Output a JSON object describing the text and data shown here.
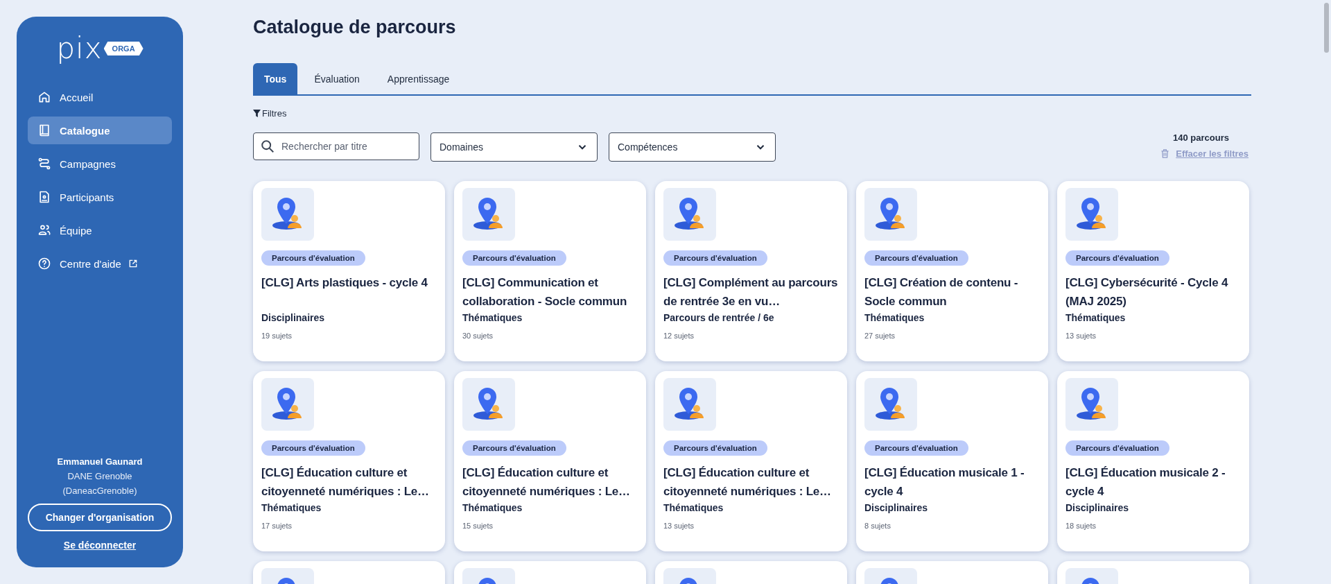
{
  "sidebar": {
    "logo": {
      "word": "pix",
      "badge": "ORGA"
    },
    "items": [
      {
        "label": "Accueil",
        "kind": "home",
        "selected": false,
        "external": false
      },
      {
        "label": "Catalogue",
        "kind": "book",
        "selected": true,
        "external": false
      },
      {
        "label": "Campagnes",
        "kind": "route",
        "selected": false,
        "external": false
      },
      {
        "label": "Participants",
        "kind": "person",
        "selected": false,
        "external": false
      },
      {
        "label": "Équipe",
        "kind": "team",
        "selected": false,
        "external": false
      },
      {
        "label": "Centre d'aide",
        "kind": "help",
        "selected": false,
        "external": true
      }
    ],
    "user": {
      "name": "Emmanuel Gaunard",
      "organization": "DANE Grenoble",
      "identifier": "(DaneacGrenoble)"
    },
    "change_button": "Changer d'organisation",
    "logout_link": "Se déconnecter"
  },
  "page_title": "Catalogue de parcours",
  "tabs": [
    {
      "label": "Tous",
      "selected": true
    },
    {
      "label": "Évaluation",
      "selected": false
    },
    {
      "label": "Apprentissage",
      "selected": false
    }
  ],
  "filters": {
    "label": "Filtres",
    "search": {
      "placeholder": "Rechercher par titre"
    },
    "dropdowns": [
      "Domaines",
      "Compétences"
    ],
    "count": "140 parcours",
    "clear_link": "Effacer les filtres"
  },
  "cards": [
    {
      "kind": "full",
      "tag": "Parcours d'évaluation",
      "title": "[CLG] Arts plastiques - cycle 4",
      "category": "Disciplinaires",
      "subjects": "19 sujets"
    },
    {
      "kind": "full",
      "tag": "Parcours d'évaluation",
      "title": "[CLG] Communication et collaboration - Socle commun",
      "category": "Thématiques",
      "subjects": "30 sujets"
    },
    {
      "kind": "full",
      "tag": "Parcours d'évaluation",
      "title": "[CLG] Complément au parcours de rentrée 3e en vu…",
      "category": "Parcours de rentrée / 6e",
      "subjects": "12 sujets"
    },
    {
      "kind": "full",
      "tag": "Parcours d'évaluation",
      "title": "[CLG] Création de contenu - Socle commun",
      "category": "Thématiques",
      "subjects": "27 sujets"
    },
    {
      "kind": "full",
      "tag": "Parcours d'évaluation",
      "title": "[CLG] Cybersécurité - Cycle 4 (MAJ 2025)",
      "category": "Thématiques",
      "subjects": "13 sujets"
    },
    {
      "kind": "full",
      "tag": "Parcours d'évaluation",
      "title": "[CLG] Éducation culture et citoyenneté numériques : Le…",
      "category": "Thématiques",
      "subjects": "17 sujets"
    },
    {
      "kind": "full",
      "tag": "Parcours d'évaluation",
      "title": "[CLG] Éducation culture et citoyenneté numériques : Le…",
      "category": "Thématiques",
      "subjects": "15 sujets"
    },
    {
      "kind": "full",
      "tag": "Parcours d'évaluation",
      "title": "[CLG] Éducation culture et citoyenneté numériques : Le…",
      "category": "Thématiques",
      "subjects": "13 sujets"
    },
    {
      "kind": "full",
      "tag": "Parcours d'évaluation",
      "title": "[CLG] Éducation musicale 1 - cycle 4",
      "category": "Disciplinaires",
      "subjects": "8 sujets"
    },
    {
      "kind": "full",
      "tag": "Parcours d'évaluation",
      "title": "[CLG] Éducation musicale 2 - cycle 4",
      "category": "Disciplinaires",
      "subjects": "18 sujets"
    },
    {
      "kind": "peek"
    },
    {
      "kind": "peek"
    },
    {
      "kind": "peek"
    },
    {
      "kind": "peek"
    },
    {
      "kind": "peek"
    }
  ]
}
